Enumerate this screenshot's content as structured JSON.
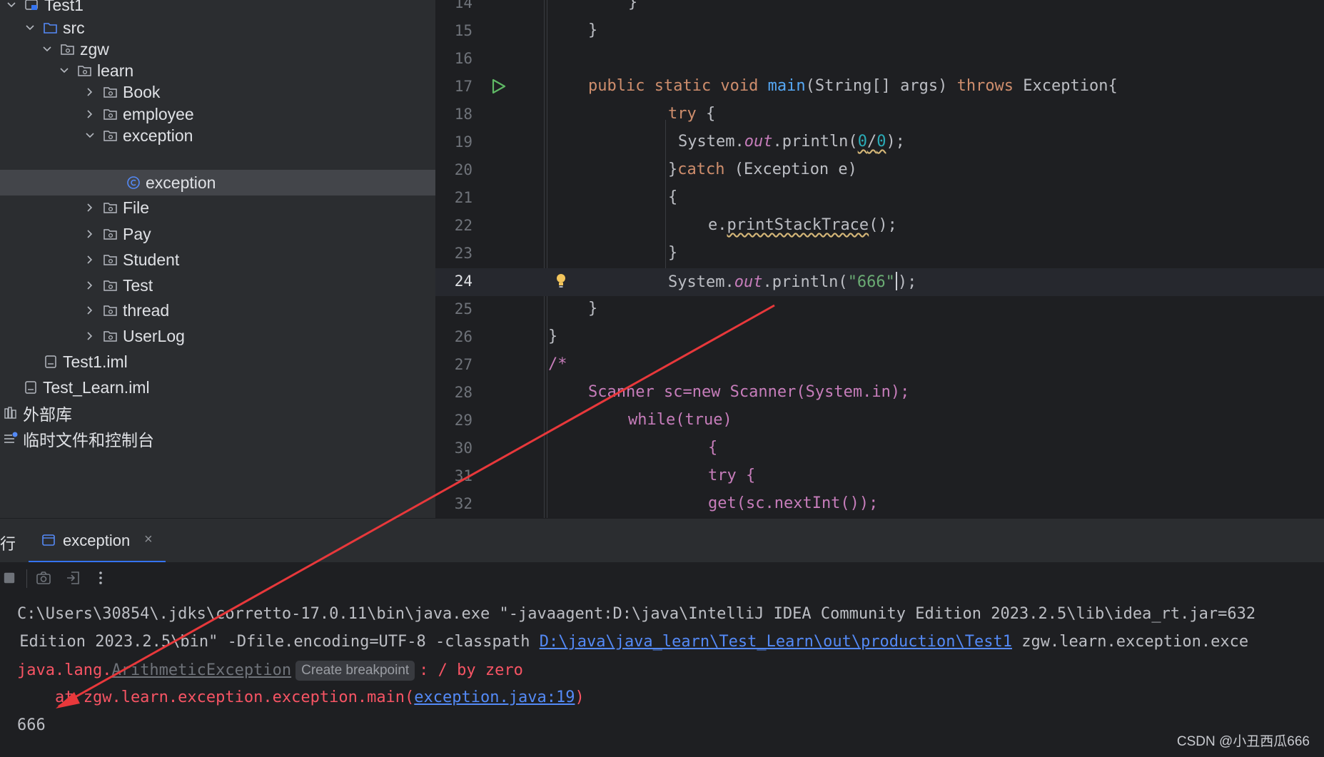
{
  "project_tree": {
    "items": [
      {
        "label": "Test1",
        "depth": 0,
        "expanded": true,
        "kind": "module"
      },
      {
        "label": "src",
        "depth": 1,
        "expanded": true,
        "kind": "source-folder"
      },
      {
        "label": "zgw",
        "depth": 2,
        "expanded": true,
        "kind": "package"
      },
      {
        "label": "learn",
        "depth": 3,
        "expanded": true,
        "kind": "package"
      },
      {
        "label": "Book",
        "depth": 4,
        "expanded": false,
        "kind": "package"
      },
      {
        "label": "employee",
        "depth": 4,
        "expanded": false,
        "kind": "package"
      },
      {
        "label": "exception",
        "depth": 4,
        "expanded": true,
        "kind": "package"
      },
      {
        "label": "exception",
        "depth": 5,
        "expanded": null,
        "kind": "class",
        "selected": true
      },
      {
        "label": "File",
        "depth": 4,
        "expanded": false,
        "kind": "package"
      },
      {
        "label": "Pay",
        "depth": 4,
        "expanded": false,
        "kind": "package"
      },
      {
        "label": "Student",
        "depth": 4,
        "expanded": false,
        "kind": "package"
      },
      {
        "label": "Test",
        "depth": 4,
        "expanded": false,
        "kind": "package"
      },
      {
        "label": "thread",
        "depth": 4,
        "expanded": false,
        "kind": "package"
      },
      {
        "label": "UserLog",
        "depth": 4,
        "expanded": false,
        "kind": "package"
      },
      {
        "label": "Test1.iml",
        "depth": 2,
        "expanded": null,
        "kind": "file"
      },
      {
        "label": "Test_Learn.iml",
        "depth": 1,
        "expanded": null,
        "kind": "file"
      },
      {
        "label": "外部库",
        "depth": 0,
        "expanded": null,
        "kind": "libraries"
      },
      {
        "label": "临时文件和控制台",
        "depth": 0,
        "expanded": null,
        "kind": "scratches"
      }
    ]
  },
  "editor": {
    "current_line": "24",
    "lines": [
      {
        "n": "14",
        "text": "}"
      },
      {
        "n": "15",
        "text": "}"
      },
      {
        "n": "16",
        "text": ""
      },
      {
        "n": "17",
        "text": "public static void main(String[] args) throws Exception{"
      },
      {
        "n": "18",
        "text": "try {"
      },
      {
        "n": "19",
        "text": "System.out.println(0/0);"
      },
      {
        "n": "20",
        "text": "}catch (Exception e)"
      },
      {
        "n": "21",
        "text": "{"
      },
      {
        "n": "22",
        "text": "e.printStackTrace();"
      },
      {
        "n": "23",
        "text": "}"
      },
      {
        "n": "24",
        "text": "System.out.println(\"666\");"
      },
      {
        "n": "25",
        "text": "}"
      },
      {
        "n": "26",
        "text": "}"
      },
      {
        "n": "27",
        "text": "/*"
      },
      {
        "n": "28",
        "text": "Scanner sc=new Scanner(System.in);"
      },
      {
        "n": "29",
        "text": "while(true)"
      },
      {
        "n": "30",
        "text": "{"
      },
      {
        "n": "31",
        "text": "try {"
      },
      {
        "n": "32",
        "text": "get(sc.nextInt());"
      }
    ]
  },
  "run_panel": {
    "title": "行",
    "tab_label": "exception",
    "tab_close": "×",
    "console": {
      "line1": "C:\\Users\\30854\\.jdks\\corretto-17.0.11\\bin\\java.exe \"-javaagent:D:\\java\\IntelliJ IDEA Community Edition 2023.2.5\\lib\\idea_rt.jar=632",
      "line2_prefix": " Edition 2023.2.5\\bin\" -Dfile.encoding=UTF-8 -classpath ",
      "line2_link": "D:\\java\\java_learn\\Test_Learn\\out\\production\\Test1",
      "line2_suffix": " zgw.learn.exception.exce",
      "line3_prefix": "java.lang.",
      "line3_class": "ArithmeticException",
      "line3_hint": "Create breakpoint",
      "line3_suffix": ": / by zero",
      "line4_prefix": "    at zgw.learn.exception.exception.main(",
      "line4_link": "exception.java:19",
      "line4_suffix": ")",
      "line5": "666"
    }
  },
  "watermark": "CSDN @小丑西瓜666",
  "colors": {
    "annotation_arrow": "#e8383b",
    "selection": "#43454a",
    "accent": "#3574f0"
  }
}
